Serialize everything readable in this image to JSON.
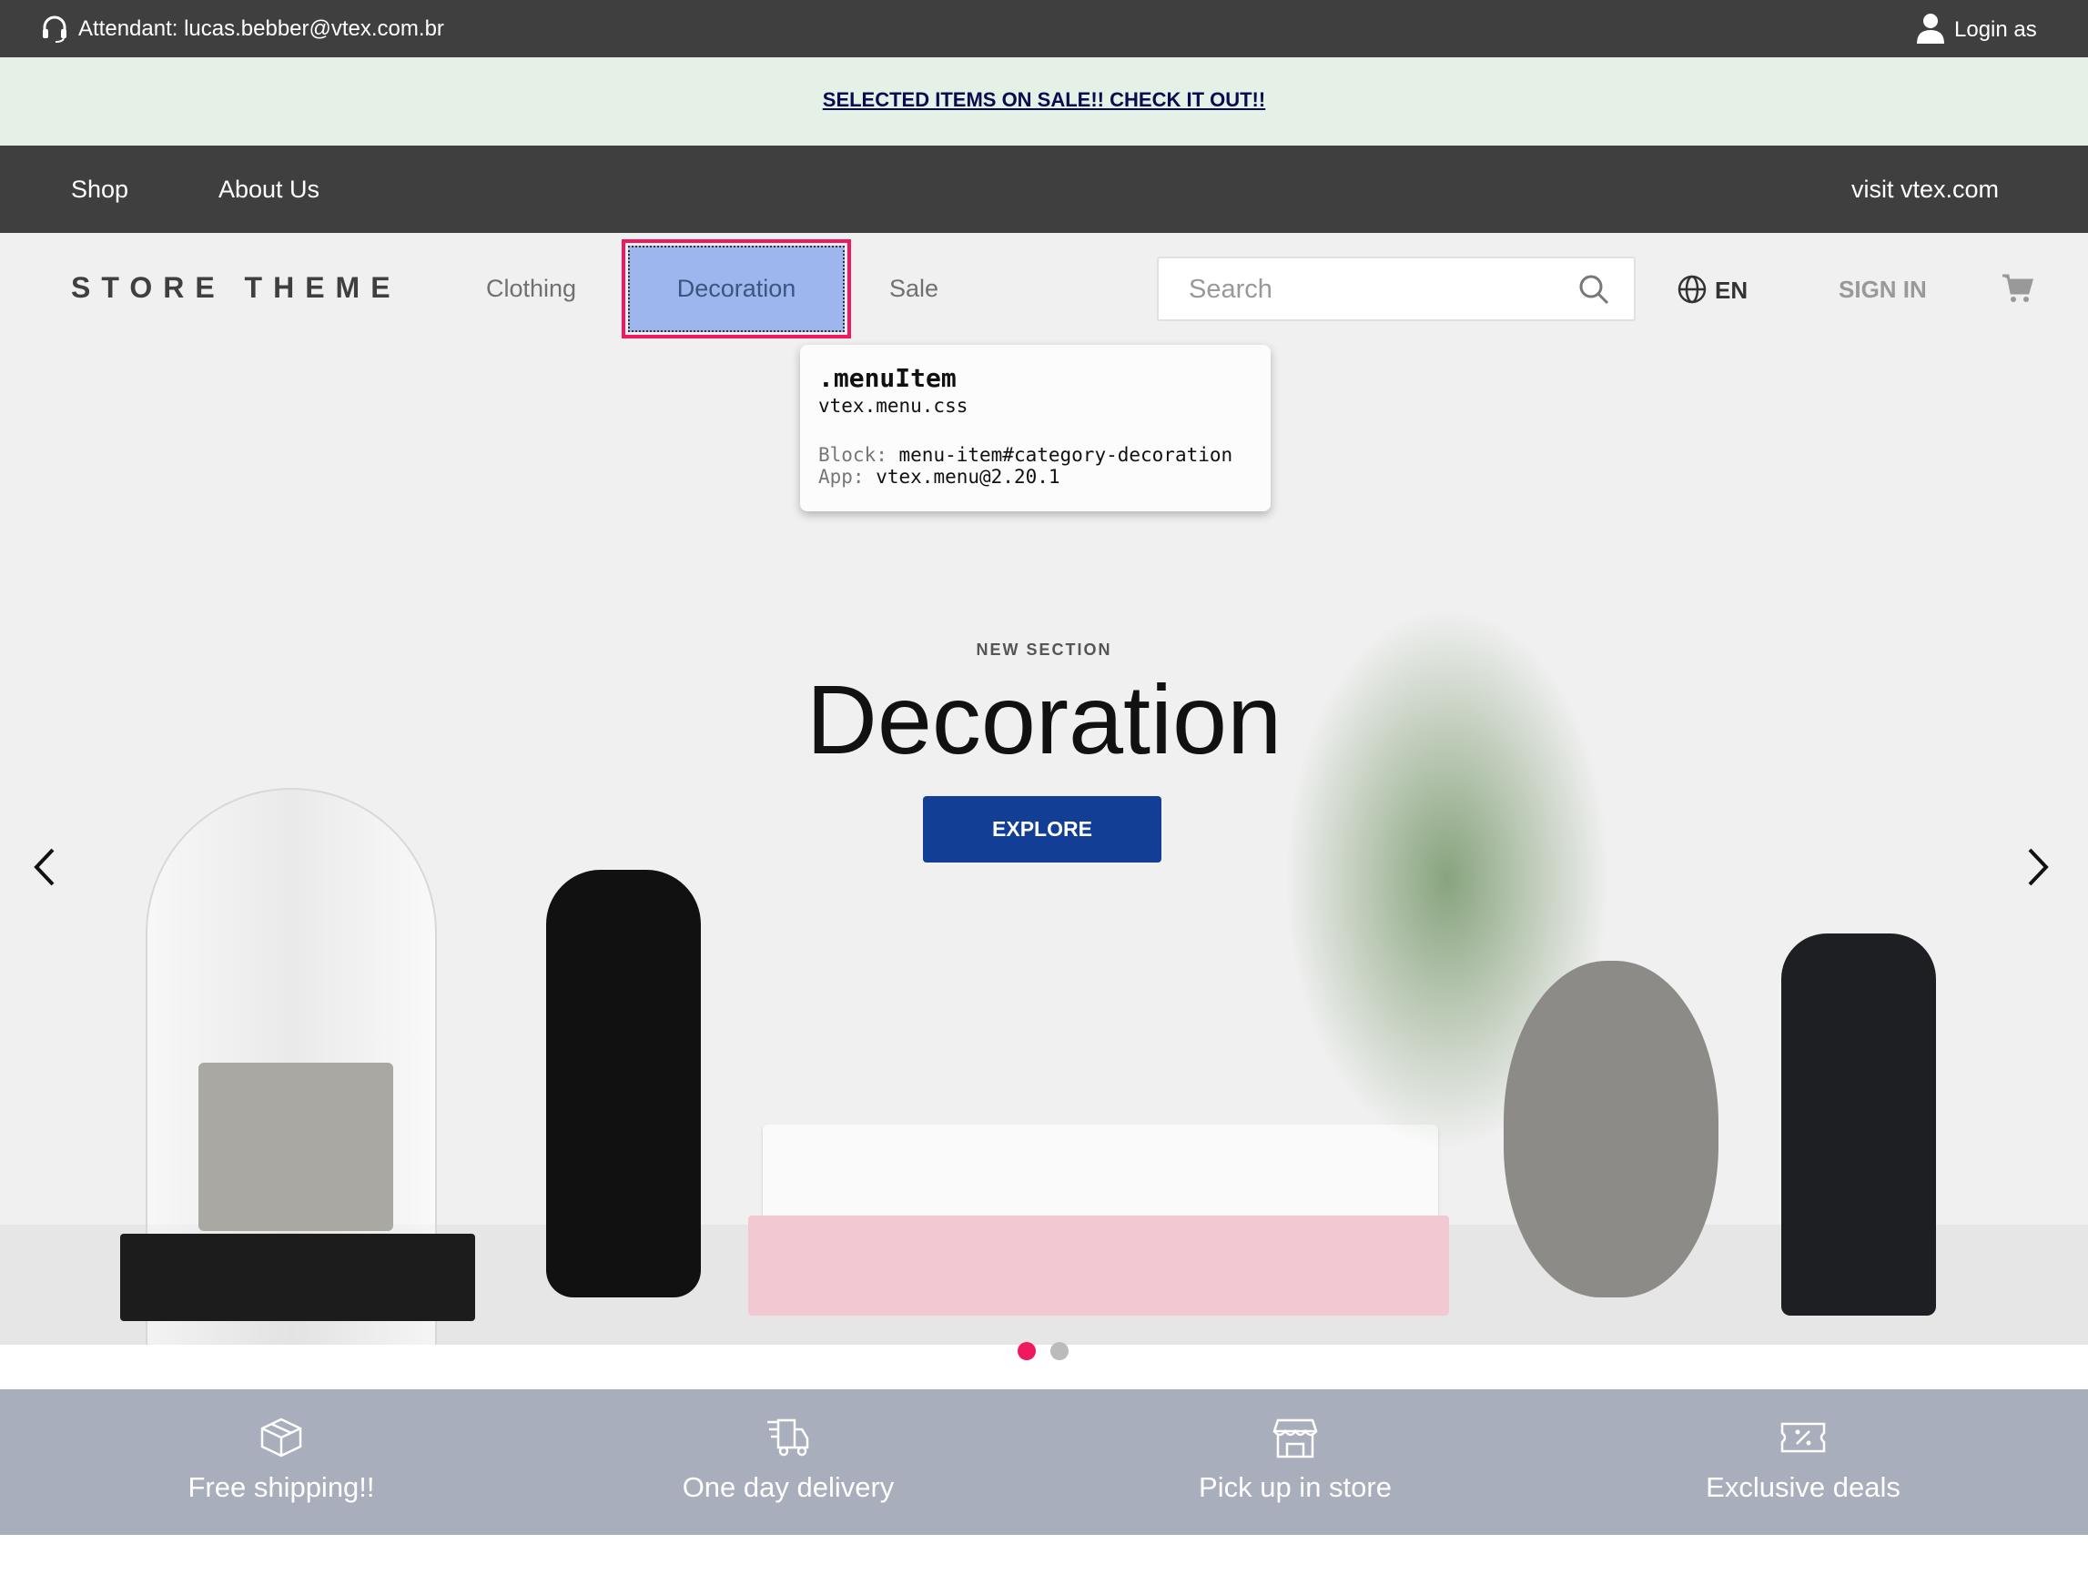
{
  "topbar": {
    "attendant": "Attendant: lucas.bebber@vtex.com.br",
    "login": "Login as"
  },
  "promo": {
    "text": "SELECTED ITEMS ON SALE!! CHECK IT OUT!!"
  },
  "nav": {
    "items": [
      "Shop",
      "About Us"
    ],
    "right_link": "visit vtex.com"
  },
  "header": {
    "logo": "STORE THEME",
    "menu": [
      "Clothing",
      "Decoration",
      "Sale"
    ],
    "search_placeholder": "Search",
    "language": "EN",
    "sign_in": "SIGN IN"
  },
  "tooltip": {
    "class_name": ".menuItem",
    "file": "vtex.menu.css",
    "block_label": "Block:",
    "block": "menu-item#category-decoration",
    "app_label": "App:",
    "app": "vtex.menu@2.20.1"
  },
  "hero": {
    "eyebrow": "NEW SECTION",
    "title": "Decoration",
    "cta": "EXPLORE",
    "slides": 2,
    "active_slide": 1
  },
  "features": [
    "Free shipping!!",
    "One day delivery",
    "Pick up in store",
    "Exclusive deals"
  ],
  "colors": {
    "accent": "#f0195f",
    "cta": "#123e96",
    "highlight": "#9db7ee"
  }
}
